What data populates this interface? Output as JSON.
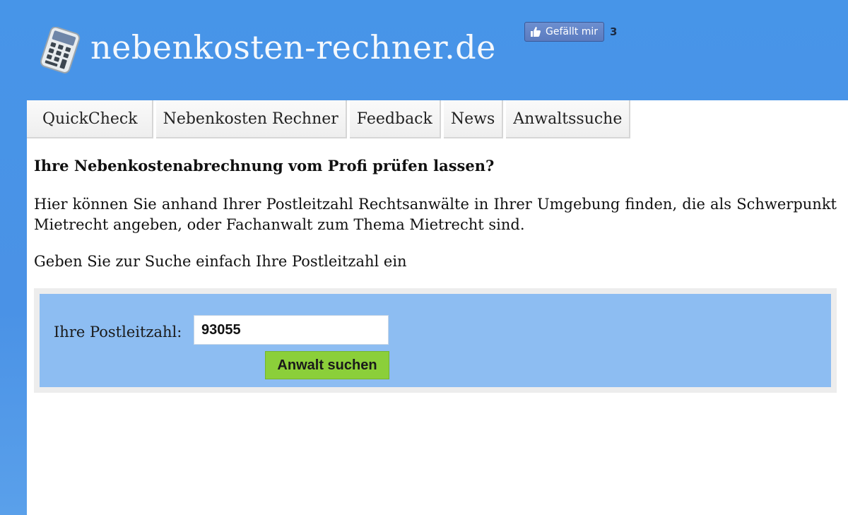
{
  "header": {
    "logo_text": "nebenkosten-rechner.de",
    "logo_icon": "calculator-icon",
    "like_button_label": "Gefällt mir",
    "like_icon": "thumbs-up-icon",
    "like_count": "3"
  },
  "nav": {
    "items": [
      {
        "label": "QuickCheck"
      },
      {
        "label": "Nebenkosten Rechner"
      },
      {
        "label": "Feedback"
      },
      {
        "label": "News"
      },
      {
        "label": "Anwaltssuche"
      }
    ]
  },
  "main": {
    "heading": "Ihre Nebenkostenabrechnung vom Profi prüfen lassen?",
    "intro": "Hier können Sie anhand Ihrer Postleitzahl Rechtsanwälte in Ihrer Umgebung finden, die als Schwerpunkt Mietrecht angeben, oder Fachanwalt zum Thema Mietrecht sind.",
    "instruction": "Geben Sie zur Suche einfach Ihre Postleitzahl ein"
  },
  "search": {
    "label": "Ihre Postleitzahl:",
    "value": "93055",
    "button_label": "Anwalt suchen"
  },
  "colors": {
    "header_blue": "#4795e8",
    "search_panel": "#8dbdf2",
    "search_button": "#8bcf3a",
    "facebook_blue": "#5b7bbf"
  }
}
